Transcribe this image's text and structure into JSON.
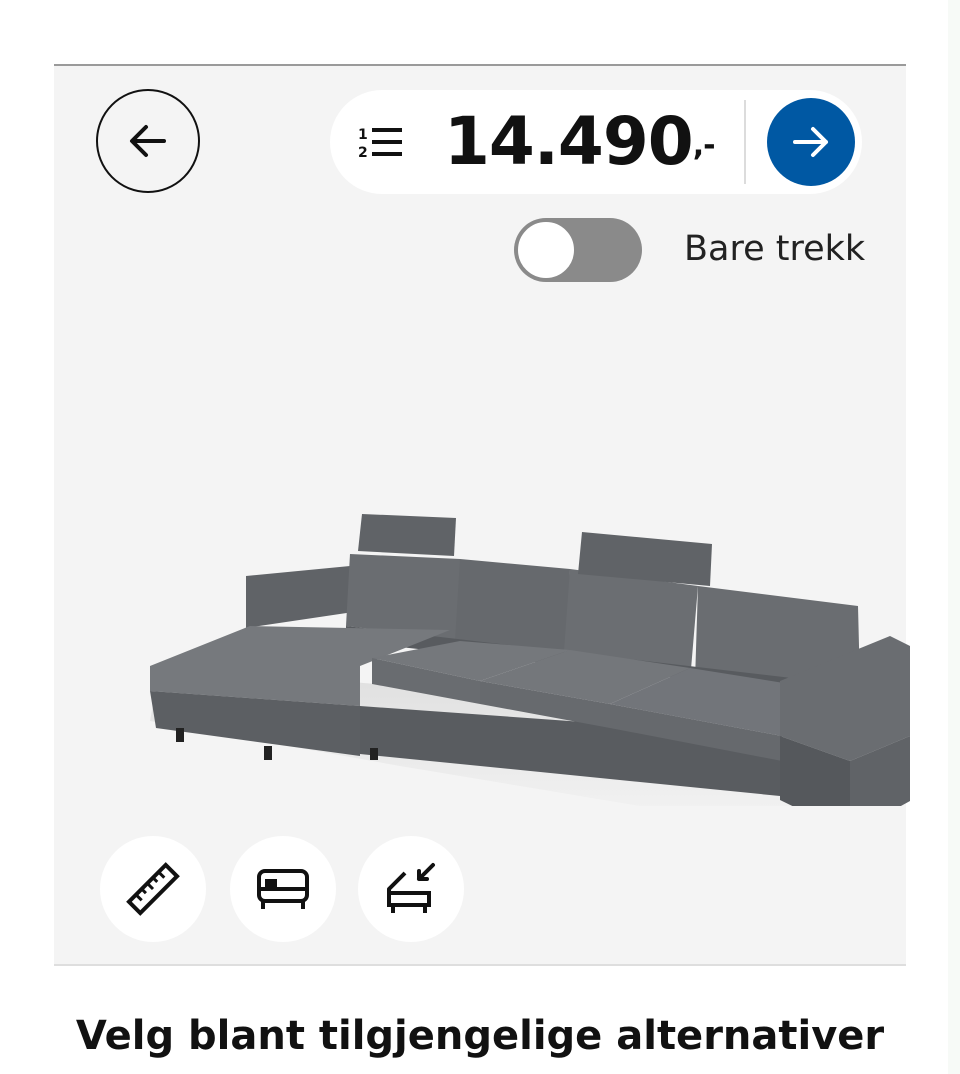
{
  "header": {
    "back_icon": "arrow-left-icon",
    "list_icon": "numbered-list-icon",
    "price": "14.490",
    "price_suffix": ",-",
    "go_icon": "arrow-right-icon",
    "accent_color": "#0058a3"
  },
  "cover_toggle": {
    "label": "Bare trekk",
    "checked": false
  },
  "product_image": {
    "subject": "sofa",
    "color": "#6b6e72"
  },
  "tools": [
    {
      "icon": "ruler-icon"
    },
    {
      "icon": "sofa-bed-icon"
    },
    {
      "icon": "chaise-longue-icon"
    }
  ],
  "footer": {
    "title": "Velg blant tilgjengelige alternativer"
  }
}
